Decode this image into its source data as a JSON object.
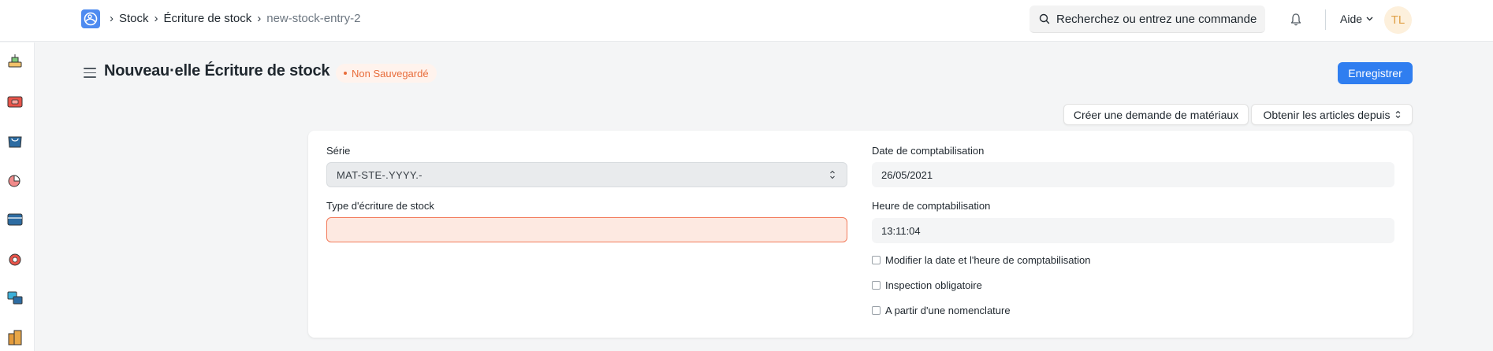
{
  "navbar": {
    "breadcrumbs": [
      "Stock",
      "Écriture de stock",
      "new-stock-entry-2"
    ],
    "search_placeholder": "Recherchez ou entrez une commande",
    "help_label": "Aide",
    "user_initials": "TL"
  },
  "sidebar": {
    "icons": [
      "stock-icon",
      "accounting-icon",
      "selling-icon",
      "reports-icon",
      "payroll-icon",
      "support-icon",
      "projects-icon",
      "assets-icon"
    ]
  },
  "page": {
    "title": "Nouveau·elle Écriture de stock",
    "status": "Non Sauvegardé",
    "save_label": "Enregistrer",
    "create_material_request_label": "Créer une demande de matériaux",
    "get_items_label": "Obtenir les articles depuis"
  },
  "form": {
    "series_label": "Série",
    "series_value": "MAT-STE-.YYYY.-",
    "entry_type_label": "Type d'écriture de stock",
    "entry_type_value": "",
    "posting_date_label": "Date de comptabilisation",
    "posting_date_value": "26/05/2021",
    "posting_time_label": "Heure de comptabilisation",
    "posting_time_value": "13:11:04",
    "checkboxes": [
      {
        "label": "Modifier la date et l'heure de comptabilisation",
        "checked": false
      },
      {
        "label": "Inspection obligatoire",
        "checked": false
      },
      {
        "label": "A partir d'une nomenclature",
        "checked": false
      }
    ]
  },
  "colors": {
    "primary": "#2f7ef0",
    "unsaved": "#e86c3a",
    "error_field": "#fde9e1"
  }
}
